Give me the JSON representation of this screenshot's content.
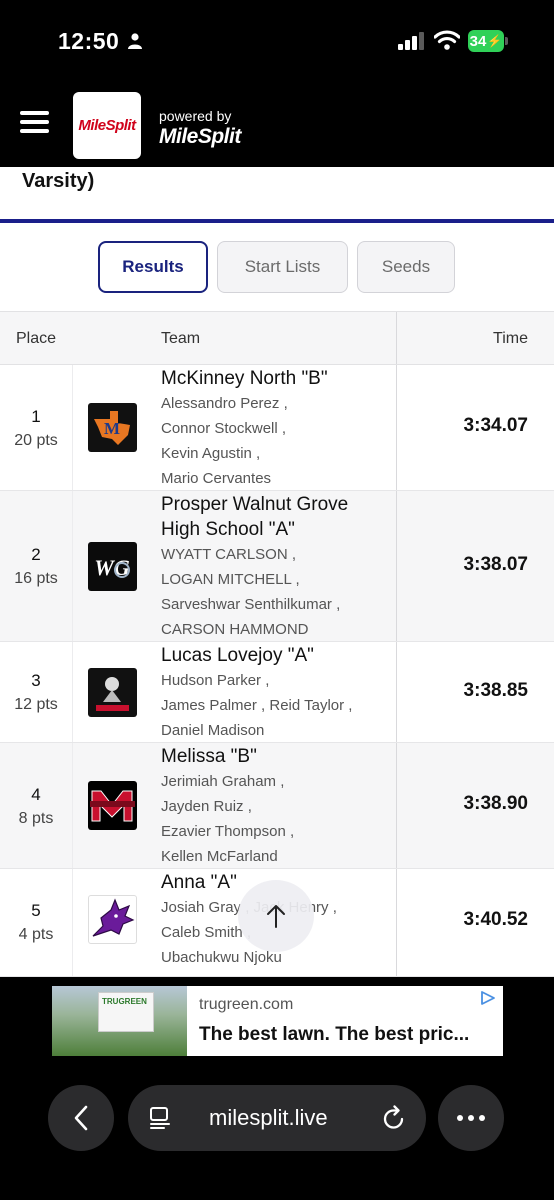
{
  "status_bar": {
    "time": "12:50",
    "battery": "34"
  },
  "header": {
    "logo_text": "MileSplit",
    "powered_by": "powered by",
    "powered_logo": "MileSplit"
  },
  "event": {
    "title_fragment": "Varsity)"
  },
  "tabs": [
    {
      "label": "Results",
      "active": true
    },
    {
      "label": "Start Lists",
      "active": false
    },
    {
      "label": "Seeds",
      "active": false
    }
  ],
  "table": {
    "headers": {
      "place": "Place",
      "team": "Team",
      "time": "Time"
    },
    "rows": [
      {
        "place": "1",
        "points": "20 pts",
        "team": "McKinney North \"B\"",
        "athletes": [
          "Alessandro Perez ,",
          "Connor Stockwell ,",
          "Kevin Agustin ,",
          "Mario Cervantes"
        ],
        "time": "3:34.07",
        "logo": "mckinney-north-logo"
      },
      {
        "place": "2",
        "points": "16 pts",
        "team": "Prosper Walnut Grove High School \"A\"",
        "athletes": [
          "WYATT CARLSON ,",
          "LOGAN MITCHELL ,",
          "Sarveshwar Senthilkumar ,",
          "CARSON HAMMOND"
        ],
        "time": "3:38.07",
        "logo": "walnut-grove-logo"
      },
      {
        "place": "3",
        "points": "12 pts",
        "team": "Lucas Lovejoy \"A\"",
        "athletes": [
          "Hudson Parker ,",
          "James Palmer ,  Reid Taylor ,",
          "Daniel Madison"
        ],
        "time": "3:38.85",
        "logo": "lovejoy-logo"
      },
      {
        "place": "4",
        "points": "8 pts",
        "team": "Melissa \"B\"",
        "athletes": [
          "Jerimiah Graham ,",
          "Jayden Ruiz ,",
          "Ezavier Thompson ,",
          "Kellen McFarland"
        ],
        "time": "3:38.90",
        "logo": "melissa-logo"
      },
      {
        "place": "5",
        "points": "4 pts",
        "team": "Anna \"A\"",
        "athletes": [
          "Josiah Gray ,  Jack Henry ,",
          "Caleb Smith ,",
          "Ubachukwu Njoku"
        ],
        "time": "3:40.52",
        "logo": "anna-coyote-logo"
      }
    ]
  },
  "ad": {
    "sign_text": "TRUGREEN",
    "domain": "trugreen.com",
    "headline": "The best lawn. The best pric..."
  },
  "browser": {
    "url": "milesplit.live"
  },
  "colors": {
    "accent": "#1a237e",
    "brand_red": "#d0021b",
    "battery_green": "#30d158"
  }
}
